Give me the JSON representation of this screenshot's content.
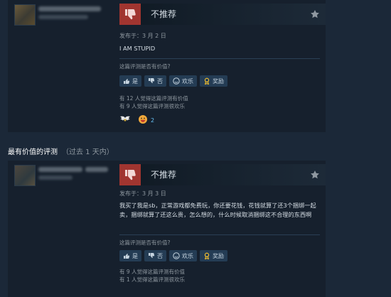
{
  "reviews": [
    {
      "recommendation": "不推荐",
      "posted": "发布于：3 月 2 日",
      "text": "I AM STUPID",
      "helpful_question": "这篇评测是否有价值?",
      "buttons": {
        "yes": "是",
        "no": "否",
        "funny": "欢乐",
        "award": "奖励"
      },
      "helpful_count": "有 12 人觉得这篇评测有价值",
      "funny_count": "有 9 人觉得这篇评测很欢乐",
      "awards": [
        {
          "icon": "wings-award-icon",
          "count": ""
        },
        {
          "icon": "grin-award-icon",
          "count": "2"
        }
      ]
    },
    {
      "recommendation": "不推荐",
      "posted": "发布于：3 月 3 日",
      "text": "我买了我是sb，正常游戏都免费玩，你还要花钱，花钱就算了还3个捆绑一起卖，捆绑就算了还这么贵，怎么想的，什么时候取消捆绑这不合理的东西啊",
      "helpful_question": "这篇评测是否有价值?",
      "buttons": {
        "yes": "是",
        "no": "否",
        "funny": "欢乐",
        "award": "奖励"
      },
      "helpful_count": "有 9 人觉得这篇评测有价值",
      "funny_count": "有 1 人觉得这篇评测很欢乐"
    }
  ],
  "section": {
    "title": "最有价值的评测",
    "period": "（过去 1 天内）"
  },
  "colors": {
    "thumb_down_bg": "#a13530",
    "background": "#1b2838",
    "accent": "#66c0f4"
  }
}
